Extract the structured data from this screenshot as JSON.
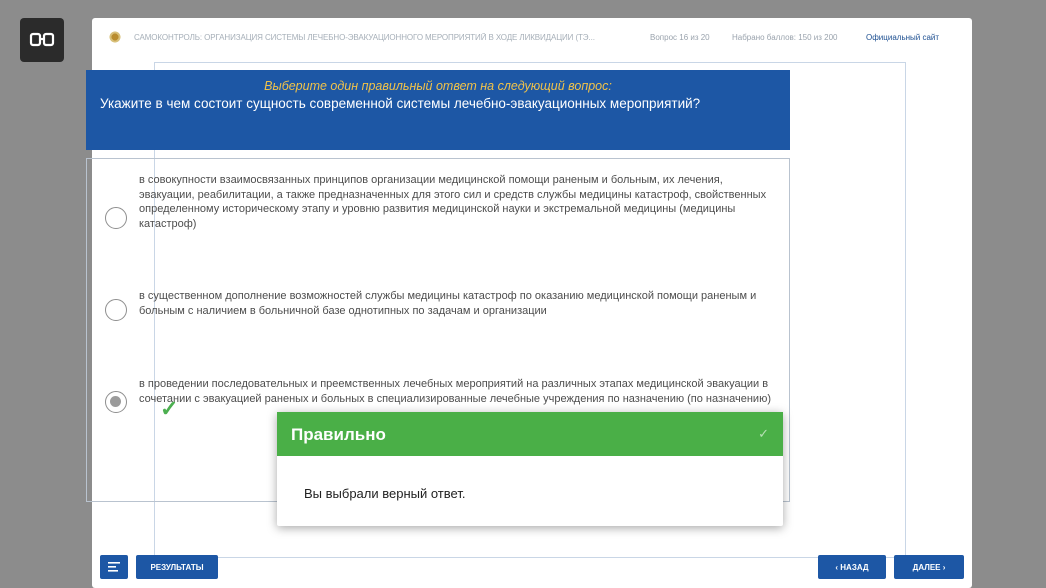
{
  "accessibility": {
    "icon": "glasses-icon"
  },
  "header": {
    "title": "САМОКОНТРОЛЬ: ОРГАНИЗАЦИЯ СИСТЕМЫ ЛЕЧЕБНО-ЭВАКУАЦИОННОГО МЕРОПРИЯТИЙ В ХОДЕ ЛИКВИДАЦИИ (ТЭ...",
    "question_counter": "Вопрос 16 из 20",
    "score": "Набрано баллов: 150 из 200",
    "official_site": "Официальный сайт"
  },
  "question": {
    "hint": "Выберите один правильный ответ на следующий вопрос:",
    "text": "Укажите в чем состоит сущность современной системы лечебно-эвакуационных мероприятий?"
  },
  "options": [
    {
      "text": "в совокупности взаимосвязанных принципов организации медицинской помощи раненым и больным, их лечения, эвакуации, реабилитации, а также предназначенных для этого сил и средств службы медицины катастроф, свойственных определенному историческому этапу и уровню развития медицинской науки и экстремальной медицины (медицины катастроф)"
    },
    {
      "text": "в существенном дополнение возможностей службы медицины катастроф по оказанию медицинской помощи раненым и больным с наличием в больничной базе однотипных по задачам и организации"
    },
    {
      "text": "в проведении последовательных и преемственных лечебных мероприятий на различных этапах медицинской эвакуации в сочетании с эвакуацией раненых и больных в специализированные лечебные учреждения по назначению (по назначению)"
    }
  ],
  "selected_index": 2,
  "modal": {
    "title": "Правильно",
    "message": "Вы выбрали верный ответ.",
    "close": "✓"
  },
  "footer": {
    "results": "РЕЗУЛЬТАТЫ",
    "back": "‹ НАЗАД",
    "next": "ДАЛЕЕ ›"
  },
  "colors": {
    "primary": "#1d57a5",
    "hint": "#f0c24a",
    "success": "#4aaf47",
    "background": "#8c8c8c"
  }
}
